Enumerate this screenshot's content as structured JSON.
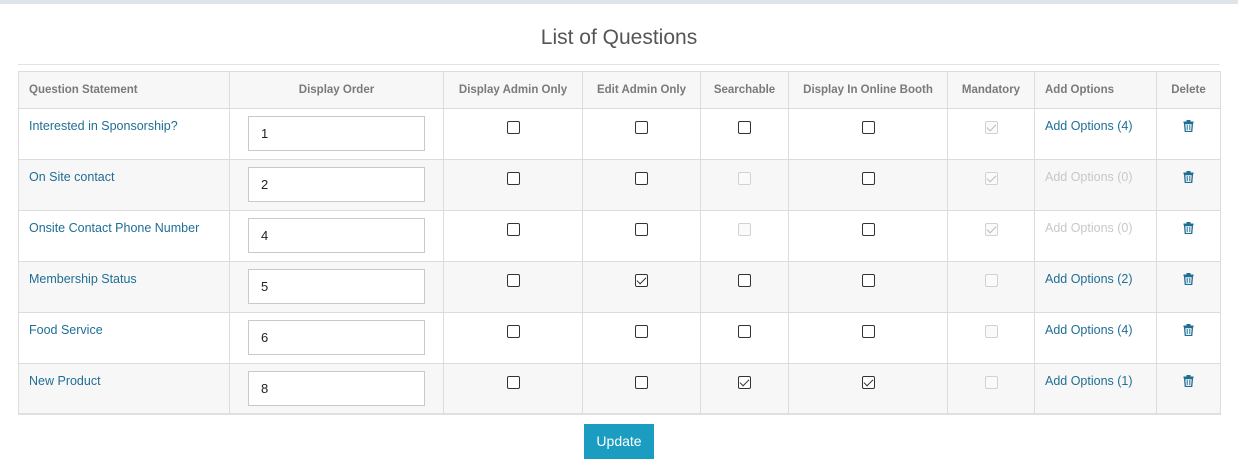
{
  "page": {
    "title": "List of Questions"
  },
  "table": {
    "headers": {
      "question": "Question Statement",
      "display_order": "Display Order",
      "display_admin_only": "Display Admin Only",
      "edit_admin_only": "Edit Admin Only",
      "searchable": "Searchable",
      "display_online_booth": "Display In Online Booth",
      "mandatory": "Mandatory",
      "add_options": "Add Options",
      "delete": "Delete"
    },
    "rows": [
      {
        "question": "Interested in Sponsorship?",
        "order": "1",
        "display_admin_only": false,
        "edit_admin_only": false,
        "searchable": {
          "checked": false,
          "enabled": true
        },
        "online_booth": false,
        "mandatory": {
          "checked": true,
          "enabled": false
        },
        "options": {
          "label": "Add Options (4)",
          "enabled": true
        }
      },
      {
        "question": "On Site contact",
        "order": "2",
        "display_admin_only": false,
        "edit_admin_only": false,
        "searchable": {
          "checked": false,
          "enabled": false
        },
        "online_booth": false,
        "mandatory": {
          "checked": true,
          "enabled": false
        },
        "options": {
          "label": "Add Options (0)",
          "enabled": false
        }
      },
      {
        "question": "Onsite Contact Phone Number",
        "order": "4",
        "display_admin_only": false,
        "edit_admin_only": false,
        "searchable": {
          "checked": false,
          "enabled": false
        },
        "online_booth": false,
        "mandatory": {
          "checked": true,
          "enabled": false
        },
        "options": {
          "label": "Add Options (0)",
          "enabled": false
        }
      },
      {
        "question": "Membership Status",
        "order": "5",
        "display_admin_only": false,
        "edit_admin_only": true,
        "searchable": {
          "checked": false,
          "enabled": true
        },
        "online_booth": false,
        "mandatory": {
          "checked": false,
          "enabled": false
        },
        "options": {
          "label": "Add Options (2)",
          "enabled": true
        }
      },
      {
        "question": "Food Service",
        "order": "6",
        "display_admin_only": false,
        "edit_admin_only": false,
        "searchable": {
          "checked": false,
          "enabled": true
        },
        "online_booth": false,
        "mandatory": {
          "checked": false,
          "enabled": false
        },
        "options": {
          "label": "Add Options (4)",
          "enabled": true
        }
      },
      {
        "question": "New Product",
        "order": "8",
        "display_admin_only": false,
        "edit_admin_only": false,
        "searchable": {
          "checked": true,
          "enabled": true
        },
        "online_booth": true,
        "mandatory": {
          "checked": false,
          "enabled": false
        },
        "options": {
          "label": "Add Options (1)",
          "enabled": true
        }
      }
    ],
    "delete_icon": "trash-icon",
    "link_color": "#1f6e94"
  },
  "actions": {
    "update_label": "Update",
    "update_color": "#1a9dc0"
  }
}
